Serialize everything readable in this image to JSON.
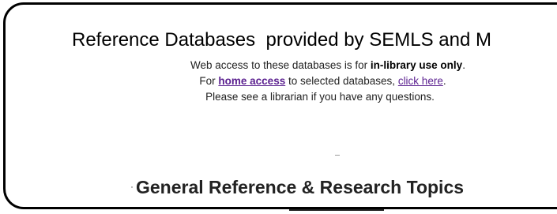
{
  "header": {
    "title": "Reference Databases  provided by SEMLS and M"
  },
  "notice": {
    "line1_prefix": "Web access to these databases is for ",
    "line1_bold": "in-library use only",
    "line1_suffix": ".",
    "line2_prefix": "For ",
    "line2_link": "home access",
    "line2_middle": " to selected databases, ",
    "line2_link2": "click here",
    "line2_suffix": ".",
    "line3": "Please see a librarian if you have any questions."
  },
  "section": {
    "title": "General Reference & Research Topics"
  },
  "colors": {
    "link": "#5a1f8f",
    "border": "#000000",
    "text": "#222222"
  }
}
